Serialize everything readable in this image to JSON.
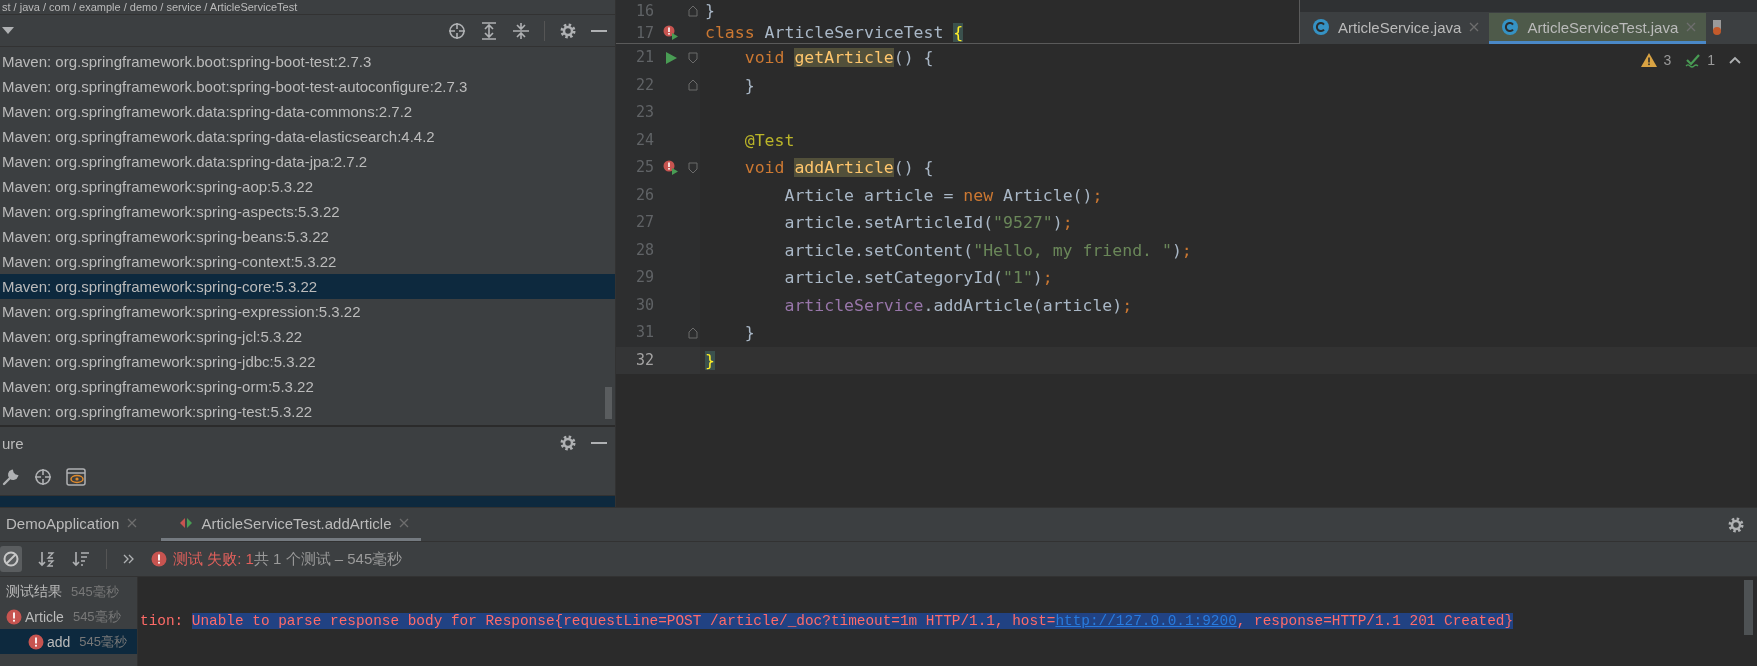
{
  "breadcrumb": {
    "text": "st / java / com / example / demo / service / ArticleServiceTest"
  },
  "project_tree": {
    "items": [
      {
        "label": "Maven: org.springframework.boot:spring-boot-test:2.7.3",
        "selected": false
      },
      {
        "label": "Maven: org.springframework.boot:spring-boot-test-autoconfigure:2.7.3",
        "selected": false
      },
      {
        "label": "Maven: org.springframework.data:spring-data-commons:2.7.2",
        "selected": false
      },
      {
        "label": "Maven: org.springframework.data:spring-data-elasticsearch:4.4.2",
        "selected": false
      },
      {
        "label": "Maven: org.springframework.data:spring-data-jpa:2.7.2",
        "selected": false
      },
      {
        "label": "Maven: org.springframework:spring-aop:5.3.22",
        "selected": false
      },
      {
        "label": "Maven: org.springframework:spring-aspects:5.3.22",
        "selected": false
      },
      {
        "label": "Maven: org.springframework:spring-beans:5.3.22",
        "selected": false
      },
      {
        "label": "Maven: org.springframework:spring-context:5.3.22",
        "selected": false
      },
      {
        "label": "Maven: org.springframework:spring-core:5.3.22",
        "selected": true
      },
      {
        "label": "Maven: org.springframework:spring-expression:5.3.22",
        "selected": false
      },
      {
        "label": "Maven: org.springframework:spring-jcl:5.3.22",
        "selected": false
      },
      {
        "label": "Maven: org.springframework:spring-jdbc:5.3.22",
        "selected": false
      },
      {
        "label": "Maven: org.springframework:spring-orm:5.3.22",
        "selected": false
      },
      {
        "label": "Maven: org.springframework:spring-test:5.3.22",
        "selected": false
      }
    ]
  },
  "structure_panel": {
    "title": "ure"
  },
  "editor_tabs": [
    {
      "label": "ArticleService.java",
      "selected": false
    },
    {
      "label": "ArticleServiceTest.java",
      "selected": true
    }
  ],
  "inspections": {
    "warnings": "3",
    "weak_warnings": "1"
  },
  "sticky_lines": [
    {
      "number": "16",
      "run": false,
      "error": false,
      "fold_start": false,
      "fold_end": true,
      "current": false,
      "tokens": [
        {
          "kind": "plain",
          "text": "}"
        }
      ]
    },
    {
      "number": "17",
      "run": true,
      "error": true,
      "fold_start": false,
      "fold_end": false,
      "current": false,
      "tokens": [
        {
          "kind": "keyword",
          "text": "class "
        },
        {
          "kind": "plain",
          "text": "ArticleServiceTest "
        },
        {
          "kind": "brace-match",
          "text": "{"
        }
      ]
    }
  ],
  "code_lines": [
    {
      "number": "21",
      "run": true,
      "error": false,
      "fold_start": true,
      "fold_end": false,
      "current": false,
      "tokens": [
        {
          "kind": "keyword",
          "text": "    void "
        },
        {
          "kind": "method-decl",
          "text": "getArticle"
        },
        {
          "kind": "plain",
          "text": "() {"
        }
      ]
    },
    {
      "number": "22",
      "run": false,
      "error": false,
      "fold_start": false,
      "fold_end": true,
      "current": false,
      "tokens": [
        {
          "kind": "plain",
          "text": "    }"
        }
      ]
    },
    {
      "number": "23",
      "run": false,
      "error": false,
      "fold_start": false,
      "fold_end": false,
      "current": false
    },
    {
      "number": "24",
      "run": false,
      "error": false,
      "fold_start": false,
      "fold_end": false,
      "current": false,
      "tokens": [
        {
          "kind": "annotation",
          "text": "    @Test"
        }
      ]
    },
    {
      "number": "25",
      "run": true,
      "error": true,
      "fold_start": true,
      "fold_end": false,
      "current": false,
      "tokens": [
        {
          "kind": "keyword",
          "text": "    void "
        },
        {
          "kind": "method-decl",
          "text": "addArticle"
        },
        {
          "kind": "plain",
          "text": "() {"
        }
      ]
    },
    {
      "number": "26",
      "run": false,
      "error": false,
      "fold_start": false,
      "fold_end": false,
      "current": false,
      "tokens": [
        {
          "kind": "plain",
          "text": "        Article article = "
        },
        {
          "kind": "keyword",
          "text": "new "
        },
        {
          "kind": "plain",
          "text": "Article()"
        },
        {
          "kind": "keyword",
          "text": ";"
        }
      ]
    },
    {
      "number": "27",
      "run": false,
      "error": false,
      "fold_start": false,
      "fold_end": false,
      "current": false,
      "tokens": [
        {
          "kind": "plain",
          "text": "        article.setArticleId("
        },
        {
          "kind": "string",
          "text": "\"9527\""
        },
        {
          "kind": "plain",
          "text": ")"
        },
        {
          "kind": "keyword",
          "text": ";"
        }
      ]
    },
    {
      "number": "28",
      "run": false,
      "error": false,
      "fold_start": false,
      "fold_end": false,
      "current": false,
      "tokens": [
        {
          "kind": "plain",
          "text": "        article.setContent("
        },
        {
          "kind": "string",
          "text": "\"Hello, my friend. \""
        },
        {
          "kind": "plain",
          "text": ")"
        },
        {
          "kind": "keyword",
          "text": ";"
        }
      ]
    },
    {
      "number": "29",
      "run": false,
      "error": false,
      "fold_start": false,
      "fold_end": false,
      "current": false,
      "tokens": [
        {
          "kind": "plain",
          "text": "        article.setCategoryId("
        },
        {
          "kind": "string",
          "text": "\"1\""
        },
        {
          "kind": "plain",
          "text": ")"
        },
        {
          "kind": "keyword",
          "text": ";"
        }
      ]
    },
    {
      "number": "30",
      "run": false,
      "error": false,
      "fold_start": false,
      "fold_end": false,
      "current": false,
      "tokens": [
        {
          "kind": "field",
          "text": "        articleService"
        },
        {
          "kind": "plain",
          "text": ".addArticle(article)"
        },
        {
          "kind": "keyword",
          "text": ";"
        }
      ]
    },
    {
      "number": "31",
      "run": false,
      "error": false,
      "fold_start": false,
      "fold_end": true,
      "current": false,
      "tokens": [
        {
          "kind": "plain",
          "text": "    }"
        }
      ]
    },
    {
      "number": "32",
      "run": false,
      "error": false,
      "fold_start": false,
      "fold_end": false,
      "current": true,
      "tokens": [
        {
          "kind": "brace-match",
          "text": "}"
        }
      ]
    }
  ],
  "run_tabs": [
    {
      "label": "DemoApplication",
      "selected": false
    },
    {
      "label": "ArticleServiceTest.addArticle",
      "selected": true
    }
  ],
  "test_status": {
    "failed": "测试 失败: 1",
    "summary": "共 1 个测试 – 545毫秒"
  },
  "test_tree": [
    {
      "label": "测试结果",
      "time": "545毫秒",
      "failed": false,
      "selected": false
    },
    {
      "label": "Article",
      "time": "545毫秒",
      "failed": true,
      "selected": false
    },
    {
      "label": "add",
      "time": "545毫秒",
      "failed": true,
      "selected": true
    }
  ],
  "console": {
    "prefix": "tion: ",
    "message": "Unable to parse response body for Response{requestLine=POST /article/_doc?timeout=1m HTTP/1.1, host=",
    "link": "http://127.0.0.1:9200",
    "suffix": ", response=HTTP/1.1 201 Created}"
  }
}
